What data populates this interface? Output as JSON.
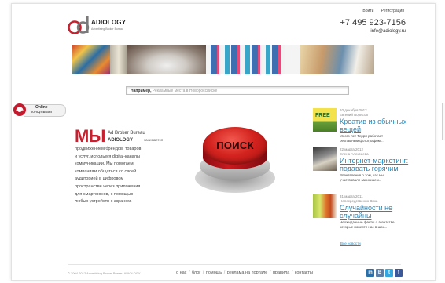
{
  "header": {
    "logo_name": "ADIOLOGY",
    "logo_tagline": "Advertising Broker Bureau",
    "top_links": [
      "Войти",
      "Регистрация"
    ],
    "phone": "+7 495 923-7156",
    "email": "info@adiology.ru"
  },
  "search": {
    "example_label": "Например,",
    "placeholder": "Рекламные места в Новороссийске"
  },
  "online": {
    "line1": "Online",
    "line2": "консультант"
  },
  "intro": {
    "headline": "МЫ",
    "line1": "Ad Broker Bureau",
    "brand": "ADIOLOGY",
    "brand_tail": "занимается",
    "description": [
      "продвижением брендов, товаров",
      "и услуг, используя digital-каналы",
      "коммуникации. Мы помогаем",
      "компаниям общаться со своей",
      "аудиторией в цифровом",
      "пространстве через приложения",
      "для смартфонов, с помощью",
      "любых устройств с экраном."
    ]
  },
  "big_button": {
    "label": "ПОИСК"
  },
  "news": {
    "items": [
      {
        "date": "10 декабря 2012",
        "author": "Евгений Борисов",
        "title_lines": [
          "Креатив из обычных",
          "вещей"
        ],
        "text_lines": [
          "Много лет Терри работает",
          "рекламным фотографом..."
        ],
        "thumb_label": "FREE"
      },
      {
        "date": "22 марта 2012",
        "author": "Елена Алексеева",
        "title_lines": [
          "Интернет-маркетинг:",
          "подавать горячим"
        ],
        "text_lines": [
          "Впечатления о том, как мы",
          "участвовали захихиаем..."
        ],
        "thumb_label": ""
      },
      {
        "date": "31 марта 2011",
        "author": "Непосредственно Вика",
        "title_lines": [
          "Случайности не",
          "случайны"
        ],
        "text_lines": [
          "Неожиданные факты о агентстве",
          "которые поверти нас в шок..."
        ],
        "thumb_label": ""
      }
    ],
    "all_news": "Все новости"
  },
  "footer": {
    "copyright": "© 2004-2012 Advertising Broker Bureau ADIOLOGY",
    "nav": [
      "о нас",
      "блог",
      "помощь",
      "реклама на портале",
      "правила",
      "контакты"
    ],
    "social": [
      "in",
      "B",
      "t",
      "f"
    ]
  },
  "colors": {
    "brand_red": "#c7202f",
    "link_blue": "#1a8bc7",
    "button_red": "#d3231f"
  }
}
